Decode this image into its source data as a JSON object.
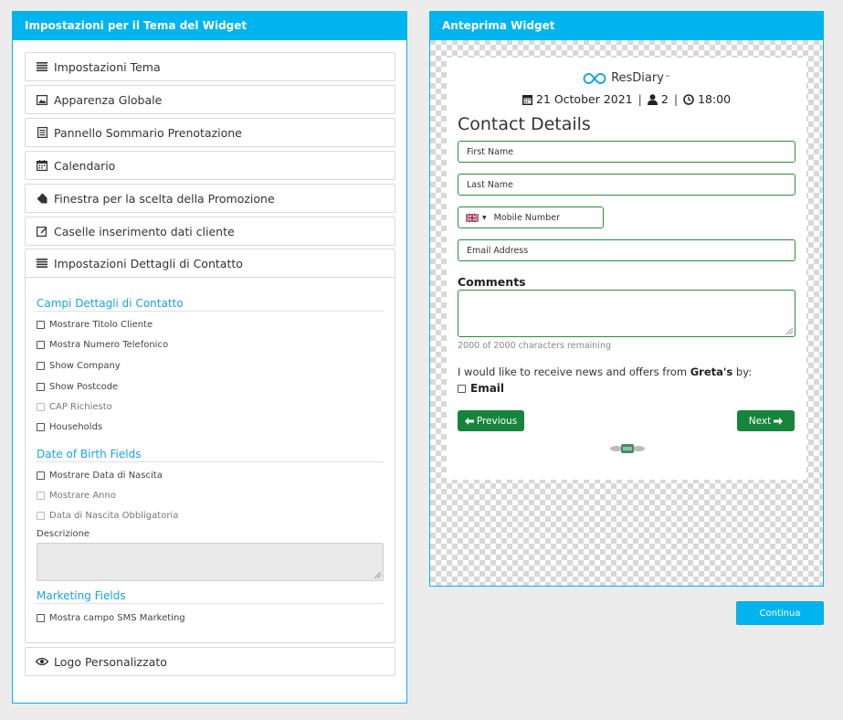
{
  "settings_panel": {
    "title": "Impostazioni per il Tema del Widget",
    "items": [
      {
        "label": "Impostazioni Tema",
        "icon": "list-icon"
      },
      {
        "label": "Apparenza Globale",
        "icon": "image-icon"
      },
      {
        "label": "Pannello Sommario Prenotazione",
        "icon": "document-icon"
      },
      {
        "label": "Calendario",
        "icon": "calendar-icon"
      },
      {
        "label": "Finestra per la scelta della Promozione",
        "icon": "tag-icon"
      },
      {
        "label": "Caselle inserimento dati cliente",
        "icon": "edit-icon"
      }
    ],
    "open_section": {
      "label": "Impostazioni Dettagli di Contatto",
      "icon": "list-icon",
      "contact_fields_title": "Campi Dettagli di Contatto",
      "contact_fields": [
        {
          "label": "Mostrare Titolo Cliente",
          "checked": false,
          "disabled": false
        },
        {
          "label": "Mostra Numero Telefonico",
          "checked": false,
          "disabled": false
        },
        {
          "label": "Show Company",
          "checked": false,
          "disabled": false
        },
        {
          "label": "Show Postcode",
          "checked": false,
          "disabled": false
        },
        {
          "label": "CAP Richiesto",
          "checked": false,
          "disabled": true
        },
        {
          "label": "Households",
          "checked": false,
          "disabled": false
        }
      ],
      "dob_title": "Date of Birth Fields",
      "dob_fields": [
        {
          "label": "Mostrare Data di Nascita",
          "checked": false,
          "disabled": false
        },
        {
          "label": "Mostrare Anno",
          "checked": false,
          "disabled": true
        },
        {
          "label": "Data di Nascita Obbligatoria",
          "checked": false,
          "disabled": true
        }
      ],
      "description_label": "Descrizione",
      "marketing_title": "Marketing Fields",
      "marketing_fields": [
        {
          "label": "Mostra campo SMS Marketing",
          "checked": false,
          "disabled": false
        }
      ]
    },
    "last_item": {
      "label": "Logo Personalizzato",
      "icon": "eye-icon"
    }
  },
  "preview_panel": {
    "title": "Anteprima Widget",
    "brand": "ResDiary",
    "brand_tm": "™",
    "booking": {
      "date": "21 October 2021",
      "guests": "2",
      "time": "18:00",
      "separator": "|"
    },
    "heading": "Contact Details",
    "fields": {
      "first_name": "First Name",
      "last_name": "Last Name",
      "mobile": "Mobile Number",
      "email": "Email Address"
    },
    "comments_label": "Comments",
    "chars_remaining": "2000 of 2000 characters remaining",
    "news_prefix": "I would like to receive news and offers from ",
    "news_venue": "Greta's",
    "news_suffix": " by:",
    "email_option": "Email",
    "previous_label": "Previous",
    "next_label": "Next"
  },
  "continue_label": "Continua",
  "colors": {
    "accent": "#00b4ef",
    "green": "#16843b",
    "field_border": "#2e8b3e"
  }
}
